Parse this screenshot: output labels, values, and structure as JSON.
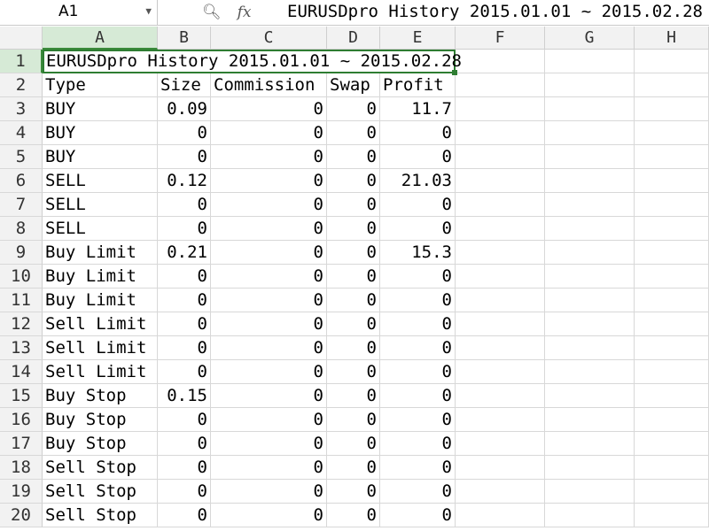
{
  "formula_bar": {
    "cell_ref": "A1",
    "search_icon": "zoom-icon",
    "fx_label": "fx",
    "content": "EURUSDpro History 2015.01.01 ~ 2015.02.28"
  },
  "columns": [
    "A",
    "B",
    "C",
    "D",
    "E",
    "F",
    "G",
    "H"
  ],
  "row_numbers": [
    "1",
    "2",
    "3",
    "4",
    "5",
    "6",
    "7",
    "8",
    "9",
    "10",
    "11",
    "12",
    "13",
    "14",
    "15",
    "16",
    "17",
    "18",
    "19",
    "20"
  ],
  "title": "EURUSDpro History 2015.01.01 ~ 2015.02.28",
  "headers": [
    "Type",
    "Size",
    "Commission",
    "Swap",
    "Profit"
  ],
  "rows": [
    [
      "BUY",
      "0.09",
      "0",
      "0",
      "11.7"
    ],
    [
      "BUY",
      "0",
      "0",
      "0",
      "0"
    ],
    [
      "BUY",
      "0",
      "0",
      "0",
      "0"
    ],
    [
      "SELL",
      "0.12",
      "0",
      "0",
      "21.03"
    ],
    [
      "SELL",
      "0",
      "0",
      "0",
      "0"
    ],
    [
      "SELL",
      "0",
      "0",
      "0",
      "0"
    ],
    [
      "Buy Limit",
      "0.21",
      "0",
      "0",
      "15.3"
    ],
    [
      "Buy Limit",
      "0",
      "0",
      "0",
      "0"
    ],
    [
      "Buy Limit",
      "0",
      "0",
      "0",
      "0"
    ],
    [
      "Sell Limit",
      "0",
      "0",
      "0",
      "0"
    ],
    [
      "Sell Limit",
      "0",
      "0",
      "0",
      "0"
    ],
    [
      "Sell Limit",
      "0",
      "0",
      "0",
      "0"
    ],
    [
      "Buy Stop",
      "0.15",
      "0",
      "0",
      "0"
    ],
    [
      "Buy Stop",
      "0",
      "0",
      "0",
      "0"
    ],
    [
      "Buy Stop",
      "0",
      "0",
      "0",
      "0"
    ],
    [
      "Sell Stop",
      "0",
      "0",
      "0",
      "0"
    ],
    [
      "Sell Stop",
      "0",
      "0",
      "0",
      "0"
    ],
    [
      "Sell Stop",
      "0",
      "0",
      "0",
      "0"
    ]
  ],
  "selection": {
    "active_cell": "A1",
    "accent_color": "#2e7d32"
  }
}
